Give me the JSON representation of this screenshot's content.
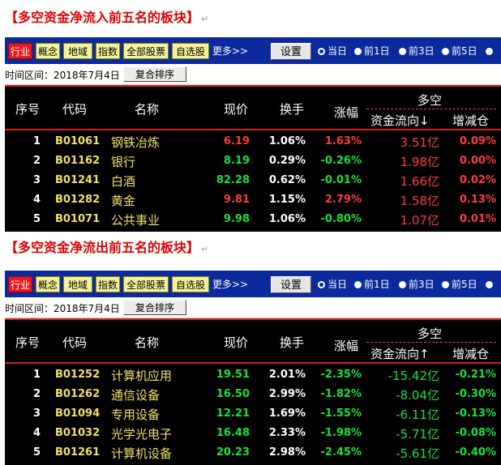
{
  "headings": {
    "inflow": "【多空资金净流入前五名的板块】",
    "outflow": "【多空资金净流出前五名的板块】",
    "mark": "↵"
  },
  "tabs": [
    "行业",
    "概念",
    "地域",
    "指数",
    "全部股票",
    "自选股"
  ],
  "more": "更多>>",
  "settings_btn": "设置",
  "radios": [
    "当日",
    "前1日",
    "前3日",
    "前5日"
  ],
  "time_label": "时间区间：2018年7月4日",
  "sort_btn": "复合排序",
  "headers": {
    "seq": "序号",
    "code": "代码",
    "name": "名称",
    "price": "现价",
    "turnover": "换手",
    "change": "涨幅",
    "group": "多空",
    "flow_in": "资金流向↓",
    "flow_out": "资金流向↑",
    "position": "增减仓"
  },
  "colors": {
    "heading": "#e00000",
    "tabbar": "#0c2a9c",
    "up": "#ff3b3b",
    "down": "#18e23a",
    "code": "#f0e06a",
    "divider": "#d81e1e"
  },
  "inflow_rows": [
    {
      "seq": "1",
      "code": "B01061",
      "name": "钢铁冶炼",
      "price": "6.19",
      "turnover": "1.06%",
      "change": "1.63%",
      "flow": "3.51亿",
      "pos": "0.09%"
    },
    {
      "seq": "2",
      "code": "B01162",
      "name": "银行",
      "price": "8.19",
      "turnover": "0.29%",
      "change": "-0.26%",
      "flow": "1.98亿",
      "pos": "0.00%"
    },
    {
      "seq": "3",
      "code": "B01241",
      "name": "白酒",
      "price": "82.28",
      "turnover": "0.62%",
      "change": "-0.01%",
      "flow": "1.66亿",
      "pos": "0.02%"
    },
    {
      "seq": "4",
      "code": "B01282",
      "name": "黄金",
      "price": "9.81",
      "turnover": "1.15%",
      "change": "2.79%",
      "flow": "1.58亿",
      "pos": "0.13%"
    },
    {
      "seq": "5",
      "code": "B01071",
      "name": "公共事业",
      "price": "9.98",
      "turnover": "1.06%",
      "change": "-0.80%",
      "flow": "1.07亿",
      "pos": "0.01%"
    }
  ],
  "outflow_rows": [
    {
      "seq": "1",
      "code": "B01252",
      "name": "计算机应用",
      "price": "19.51",
      "turnover": "2.01%",
      "change": "-2.35%",
      "flow": "-15.42亿",
      "pos": "-0.21%"
    },
    {
      "seq": "2",
      "code": "B01262",
      "name": "通信设备",
      "price": "16.50",
      "turnover": "2.99%",
      "change": "-1.82%",
      "flow": "-8.04亿",
      "pos": "-0.30%"
    },
    {
      "seq": "3",
      "code": "B01094",
      "name": "专用设备",
      "price": "12.21",
      "turnover": "1.69%",
      "change": "-1.55%",
      "flow": "-6.11亿",
      "pos": "-0.13%"
    },
    {
      "seq": "4",
      "code": "B01032",
      "name": "光学光电子",
      "price": "16.48",
      "turnover": "2.33%",
      "change": "-1.98%",
      "flow": "-5.71亿",
      "pos": "-0.08%"
    },
    {
      "seq": "5",
      "code": "B01261",
      "name": "计算机设备",
      "price": "20.23",
      "turnover": "2.98%",
      "change": "-2.45%",
      "flow": "-5.61亿",
      "pos": "-0.40%"
    }
  ]
}
